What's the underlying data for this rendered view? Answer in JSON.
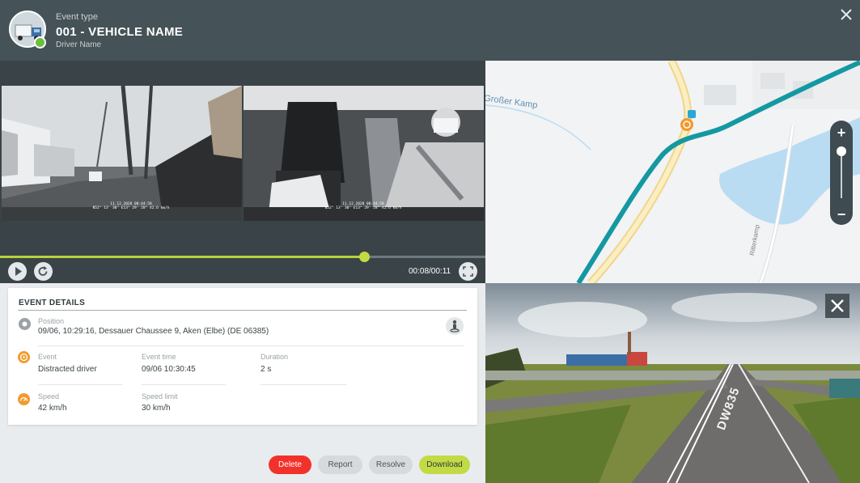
{
  "header": {
    "event_type_label": "Event type",
    "vehicle_name": "001 - VEHICLE NAME",
    "driver_name": "Driver Name"
  },
  "player": {
    "road_overlay_line1": "11.12.2020 08:44:58",
    "road_overlay_line2": "N52° 13' 30\" E13° 29' 28\" 42.6 km/h",
    "cabin_overlay_line1": "11.12.2020 08:44:58",
    "cabin_overlay_line2": "N52° 13' 30\" E13° 29' 28\" 42.6 km/h",
    "time_display": "00:08/00:11",
    "progress": 0.75
  },
  "map": {
    "street_label_1": "Großer Kamp",
    "street_label_2": "Ritterkamp"
  },
  "street_view": {
    "road_marking": "DW835"
  },
  "details": {
    "title": "EVENT DETAILS",
    "position_label": "Position",
    "position_value": "09/06, 10:29:16, Dessauer Chaussee 9, Aken (Elbe) (DE 06385)",
    "event_label": "Event",
    "event_value": "Distracted driver",
    "event_time_label": "Event time",
    "event_time_value": "09/06 10:30:45",
    "duration_label": "Duration",
    "duration_value": "2 s",
    "speed_label": "Speed",
    "speed_value": "42 km/h",
    "speed_limit_label": "Speed limit",
    "speed_limit_value": "30 km/h"
  },
  "actions": {
    "delete": "Delete",
    "report": "Report",
    "resolve": "Resolve",
    "download": "Download"
  },
  "colors": {
    "accent_green": "#c2da44",
    "delete_red": "#f2312b",
    "route_teal": "#1498a2",
    "icon_orange": "#f29a2e",
    "header_bg": "#455257"
  }
}
